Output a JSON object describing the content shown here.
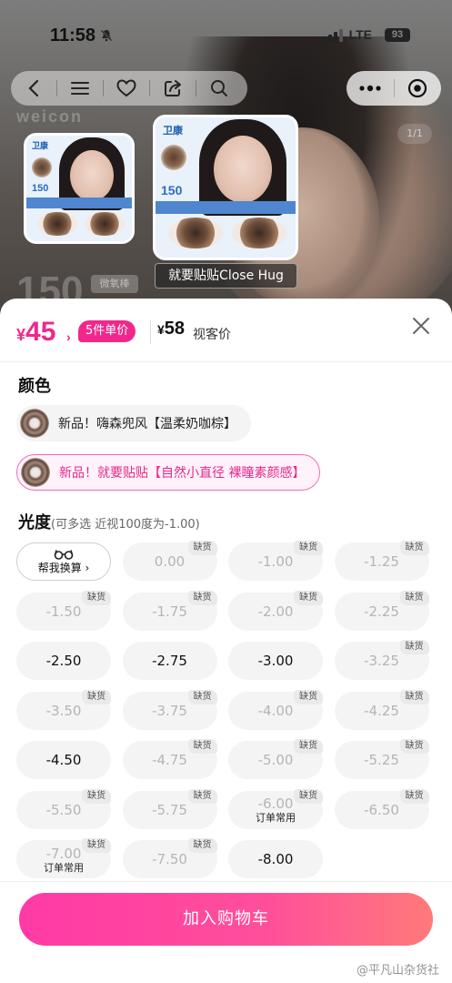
{
  "status_bar": {
    "time": "11:58",
    "network": "LTE",
    "battery": "93"
  },
  "hero": {
    "brand": "weicon",
    "badge_number": "150",
    "badge_text": "微氧棒",
    "counter": "1/1",
    "thumbnail_brand": "卫康",
    "thumbnail_number": "150",
    "caption": "就要贴贴Close Hug"
  },
  "price": {
    "currency": "¥",
    "amount": "45",
    "arrow": "›",
    "unit_badge": "5件单价",
    "sale_amount": "58",
    "sale_label": "视客价"
  },
  "color_section": {
    "title": "颜色",
    "options": [
      {
        "label": "新品！嗨森兜风【温柔奶咖棕】",
        "selected": false
      },
      {
        "label": "新品！就要贴贴【自然小直径 裸瞳素颜感】",
        "selected": true
      }
    ]
  },
  "power_section": {
    "title": "光度",
    "subtitle": "(可多选 近视100度为-1.00)",
    "helper_label": "帮我换算 ›",
    "out_of_stock_tag": "缺货",
    "options": [
      {
        "value": "0.00",
        "out_of_stock": true
      },
      {
        "value": "-1.00",
        "out_of_stock": true
      },
      {
        "value": "-1.25",
        "out_of_stock": true
      },
      {
        "value": "-1.50",
        "out_of_stock": true
      },
      {
        "value": "-1.75",
        "out_of_stock": true
      },
      {
        "value": "-2.00",
        "out_of_stock": true
      },
      {
        "value": "-2.25",
        "out_of_stock": true
      },
      {
        "value": "-2.50",
        "out_of_stock": false
      },
      {
        "value": "-2.75",
        "out_of_stock": false
      },
      {
        "value": "-3.00",
        "out_of_stock": false
      },
      {
        "value": "-3.25",
        "out_of_stock": true
      },
      {
        "value": "-3.50",
        "out_of_stock": true
      },
      {
        "value": "-3.75",
        "out_of_stock": true
      },
      {
        "value": "-4.00",
        "out_of_stock": true
      },
      {
        "value": "-4.25",
        "out_of_stock": true
      },
      {
        "value": "-4.50",
        "out_of_stock": false
      },
      {
        "value": "-4.75",
        "out_of_stock": true
      },
      {
        "value": "-5.00",
        "out_of_stock": true
      },
      {
        "value": "-5.25",
        "out_of_stock": true
      },
      {
        "value": "-5.50",
        "out_of_stock": true
      },
      {
        "value": "-5.75",
        "out_of_stock": true
      },
      {
        "value": "-6.00",
        "out_of_stock": true,
        "note": "订单常用"
      },
      {
        "value": "-6.50",
        "out_of_stock": true
      },
      {
        "value": "-7.00",
        "out_of_stock": true,
        "note": "订单常用"
      },
      {
        "value": "-7.50",
        "out_of_stock": true
      },
      {
        "value": "-8.00",
        "out_of_stock": false
      }
    ]
  },
  "footer": {
    "add_to_cart": "加入购物车",
    "watermark": "@平凡山杂货社"
  },
  "colors": {
    "accent": "#f0288c",
    "button_start": "#ff3aa6",
    "button_end": "#ff7a7a"
  }
}
